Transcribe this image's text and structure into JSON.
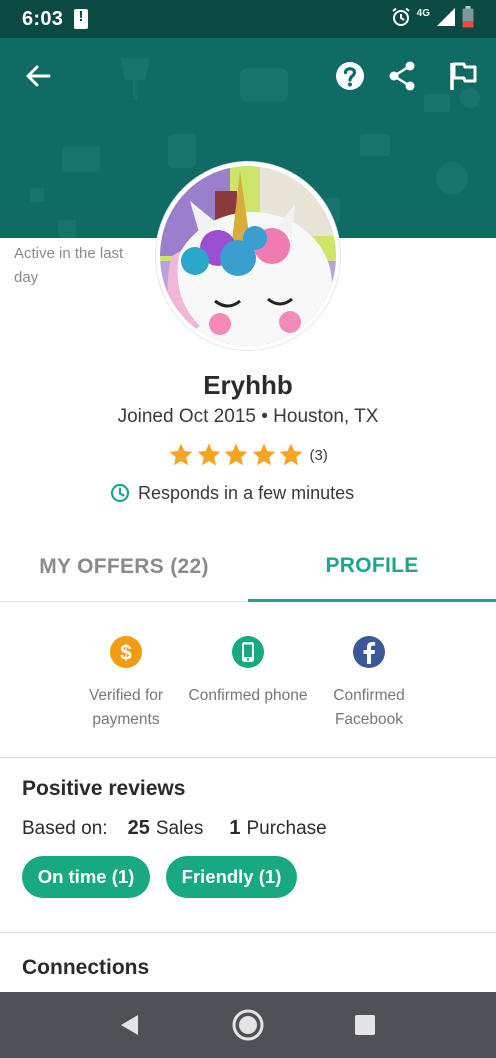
{
  "status_bar": {
    "time": "6:03",
    "network_label": "4G",
    "icons": [
      "alert-icon",
      "alarm-icon",
      "signal-icon",
      "battery-icon"
    ]
  },
  "header": {
    "background_color": "#0f6b63",
    "icons": [
      "back-arrow-icon",
      "help-icon",
      "share-icon",
      "flag-icon"
    ]
  },
  "profile": {
    "active_status": "Active in the last day",
    "username": "Eryhhb",
    "joined": "Joined Oct 2015 • Houston, TX",
    "rating_stars": 5,
    "rating_count": "(3)",
    "responds": "Responds in a few minutes",
    "star_color": "#f4a623",
    "accent_color": "#1fa58b"
  },
  "tabs": [
    {
      "label": "MY OFFERS (22)",
      "active": false
    },
    {
      "label": "PROFILE",
      "active": true
    }
  ],
  "verifications": [
    {
      "icon": "dollar-icon",
      "label": "Verified for payments",
      "color": "#f39c12"
    },
    {
      "icon": "phone-icon",
      "label": "Confirmed phone",
      "color": "#19a981"
    },
    {
      "icon": "facebook-icon",
      "label": "Confirmed Facebook",
      "color": "#3b5998"
    }
  ],
  "reviews": {
    "title": "Positive reviews",
    "based_on_label": "Based on:",
    "sales_count": "25",
    "sales_label": "Sales",
    "purchase_count": "1",
    "purchase_label": "Purchase",
    "chips": [
      "On time (1)",
      "Friendly (1)"
    ]
  },
  "connections": {
    "title": "Connections"
  },
  "nav_bar": {
    "icons": [
      "nav-back-icon",
      "nav-home-icon",
      "nav-recents-icon"
    ]
  }
}
